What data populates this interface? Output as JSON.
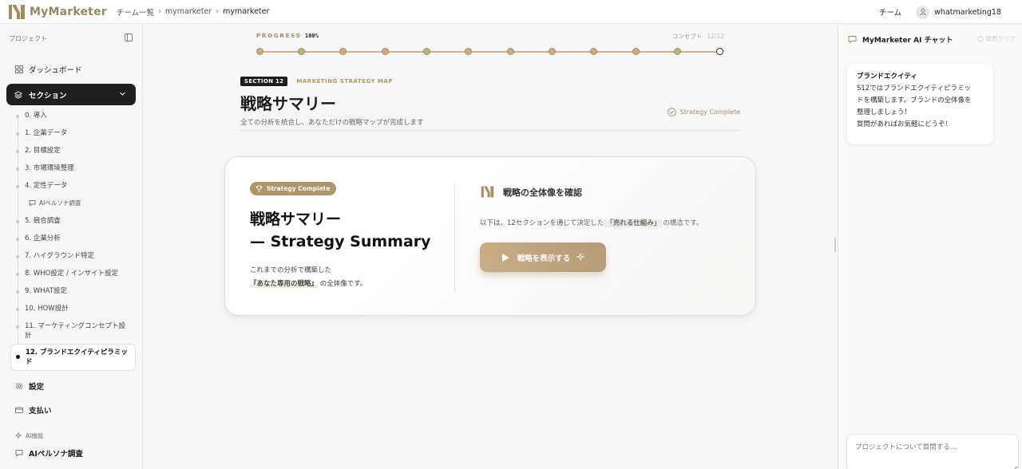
{
  "app": {
    "logo_text": "MyMarketer"
  },
  "breadcrumb": {
    "items": [
      "チーム一覧",
      "mymarketer",
      "mymarketer"
    ]
  },
  "header": {
    "team_label": "チーム",
    "username": "whatmarketing18"
  },
  "sidebar": {
    "project_label": "プロジェクト",
    "dashboard": "ダッシュボード",
    "sections_label": "セクション",
    "sections": [
      "0. 導入",
      "1. 企業データ",
      "2. 目標設定",
      "3. 市場環境整理",
      "4. 定性データ",
      "AIペルソナ調査",
      "5. 競合調査",
      "6. 企業分析",
      "7. ハイグラウンド特定",
      "8. WHO設定 / インサイト設定",
      "9. WHAT設定",
      "10. HOW設計",
      "11. マーケティングコンセプト設計",
      "12. ブランドエクイティピラミッド"
    ],
    "settings": "設定",
    "billing": "支払い",
    "ai_label": "AI機能",
    "ai_persona": "AIペルソナ調査"
  },
  "progress": {
    "label": "PROGRESS",
    "percent": "100%",
    "percent_value": 100,
    "right_label": "コンセプト",
    "count": "12/12",
    "steps_total": 12,
    "steps_done": 12
  },
  "section": {
    "tag": "SECTION 12",
    "subtitle": "MARKETING STRATEGY MAP",
    "title": "戦略サマリー",
    "description": "全ての分析を統合し、あなただけの戦略マップが完成します",
    "status": "Strategy Complete"
  },
  "card": {
    "badge": "Strategy Complete",
    "title_line1": "戦略サマリー",
    "title_line2": "— Strategy Summary",
    "desc_line1": "これまでの分析で構築した",
    "desc_highlight": "『あなた専用の戦略』",
    "desc_line2_tail": "の全体像です。",
    "right_title": "戦略の全体像を確認",
    "right_desc_head": "以下は、12セクションを通じて決定した",
    "right_desc_highlight": "「売れる仕組み」",
    "right_desc_tail": "の構造です。",
    "button": "戦略を表示する"
  },
  "chat": {
    "title": "MyMarketer AI チャット",
    "clear": "履歴クリア",
    "message_title": "ブランドエクイティ",
    "message_lines": [
      "S12ではブランドエクイティピラミッ",
      "ドを構築します。ブランドの全体像を",
      "整理しましょう！",
      "質問があればお気軽にどうぞ！"
    ],
    "input_placeholder": "プロジェクトについて質問する..."
  },
  "colors": {
    "accent": "#a8895b",
    "dark": "#1f1f1f"
  }
}
